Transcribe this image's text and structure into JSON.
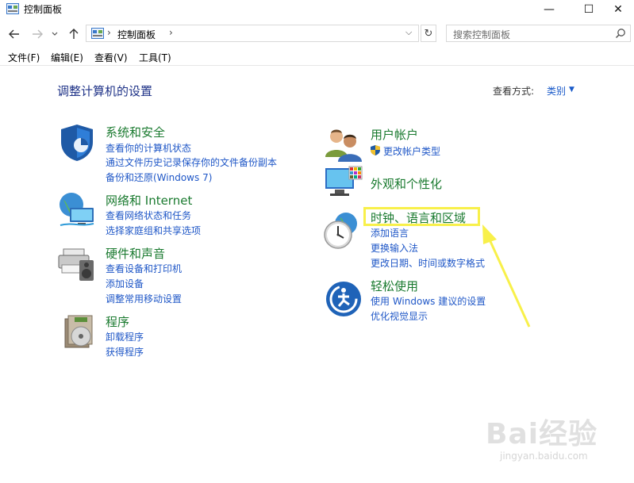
{
  "window": {
    "title": "控制面板",
    "minimize_glyph": "—",
    "maximize_glyph": "☐",
    "close_glyph": "✕"
  },
  "address_bar": {
    "back_icon": "arrow-left-icon",
    "forward_icon": "arrow-right-icon",
    "recent_icon": "chevron-down-icon",
    "up_icon": "arrow-up-icon",
    "path_separator": "›",
    "path": "控制面板",
    "dropdown_glyph": "⌵",
    "refresh_glyph": "↻"
  },
  "search": {
    "placeholder": "搜索控制面板"
  },
  "menu": [
    "文件(F)",
    "编辑(E)",
    "查看(V)",
    "工具(T)"
  ],
  "main": {
    "title": "调整计算机的设置",
    "view_by_label": "查看方式:",
    "view_by_value": "类别",
    "view_by_arrow": "▼"
  },
  "categories_left": [
    {
      "title": "系统和安全",
      "icon": "shield-icon",
      "links": [
        "查看你的计算机状态",
        "通过文件历史记录保存你的文件备份副本",
        "备份和还原(Windows 7)"
      ]
    },
    {
      "title": "网络和 Internet",
      "icon": "network-globe-icon",
      "links": [
        "查看网络状态和任务",
        "选择家庭组和共享选项"
      ]
    },
    {
      "title": "硬件和声音",
      "icon": "printer-speaker-icon",
      "links": [
        "查看设备和打印机",
        "添加设备",
        "调整常用移动设置"
      ]
    },
    {
      "title": "程序",
      "icon": "programs-disc-icon",
      "links": [
        "卸载程序",
        "获得程序"
      ]
    }
  ],
  "categories_right": [
    {
      "title": "用户帐户",
      "icon": "user-accounts-icon",
      "links": [
        "更改帐户类型"
      ]
    },
    {
      "title": "外观和个性化",
      "icon": "appearance-monitor-icon",
      "links": []
    },
    {
      "title": "时钟、语言和区域",
      "icon": "clock-globe-icon",
      "links": [
        "添加语言",
        "更换输入法",
        "更改日期、时间或数字格式"
      ]
    },
    {
      "title": "轻松使用",
      "icon": "ease-of-access-icon",
      "links": [
        "使用 Windows 建议的设置",
        "优化视觉显示"
      ]
    }
  ],
  "watermark": {
    "brand": "Bai经验",
    "url": "jingyan.baidu.com"
  },
  "colors": {
    "category_title": "#1a7a2f",
    "link": "#1f57c7",
    "page_title": "#1e3287",
    "highlight": "#f8f04a"
  }
}
